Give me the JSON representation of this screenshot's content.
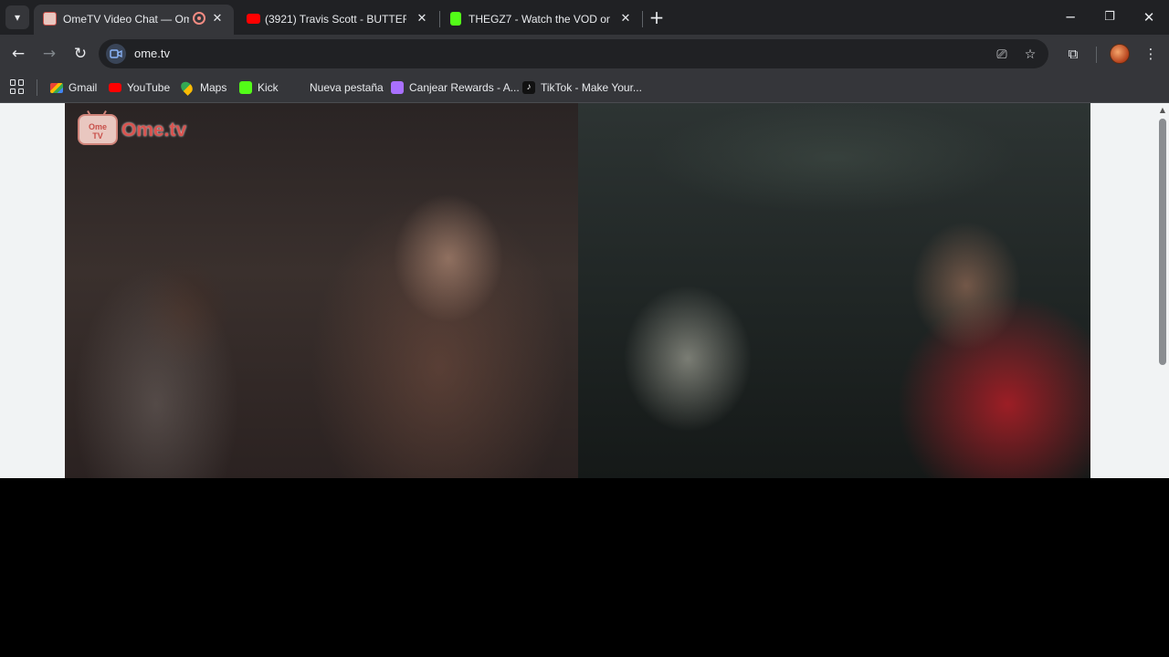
{
  "tabs": [
    {
      "title": "OmeTV Video Chat — Ome",
      "active": true,
      "favicon": "ometv-favicon",
      "recording": true
    },
    {
      "title": "(3921) Travis Scott - BUTTERFLY",
      "active": false,
      "favicon": "youtube-favicon"
    },
    {
      "title": "THEGZ7 - Watch the VOD on Ki",
      "active": false,
      "favicon": "kick-favicon"
    }
  ],
  "toolbar": {
    "url": "ome.tv"
  },
  "bookmarks": [
    {
      "label": "Gmail",
      "icon": "gmail-icon"
    },
    {
      "label": "YouTube",
      "icon": "youtube-icon"
    },
    {
      "label": "Maps",
      "icon": "maps-icon"
    },
    {
      "label": "Kick",
      "icon": "kick-icon"
    },
    {
      "label": "Nueva pestaña",
      "icon": ""
    },
    {
      "label": "Canjear Rewards - A...",
      "icon": "twitch-icon"
    },
    {
      "label": "TikTok - Make Your...",
      "icon": "tiktok-icon"
    }
  ],
  "logo": {
    "badge_line1": "Ome",
    "badge_line2": "TV",
    "text": "Ome.tv"
  },
  "colors": {
    "tab_bg": "#202124",
    "toolbar_bg": "#35363a",
    "logo_red": "#d9534f"
  }
}
